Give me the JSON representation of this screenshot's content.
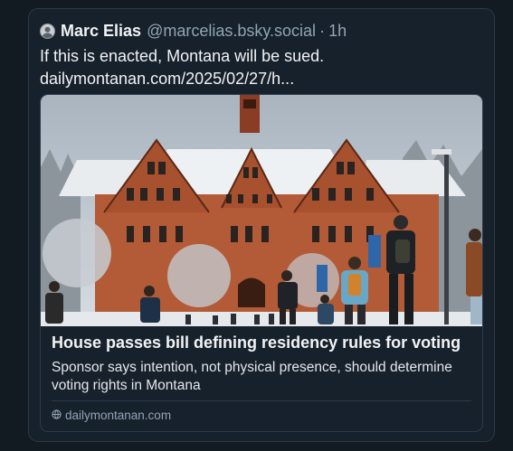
{
  "post": {
    "author_name": "Marc Elias",
    "author_handle": "@marcelias.bsky.social",
    "separator": "·",
    "time": "1h",
    "text_line1": "If this is enacted, Montana will be sued.",
    "text_line2": "dailymontanan.com/2025/02/27/h..."
  },
  "card": {
    "title": "House passes bill defining residency rules for voting",
    "description": "Sponsor says intention, not physical presence, should determine voting rights in Montana",
    "source": "dailymontanan.com"
  },
  "colors": {
    "background": "#121a22",
    "post_bg": "#17212c",
    "border": "#2c3a48",
    "text_primary": "#f1f3f5",
    "text_secondary": "#93a4b5"
  }
}
